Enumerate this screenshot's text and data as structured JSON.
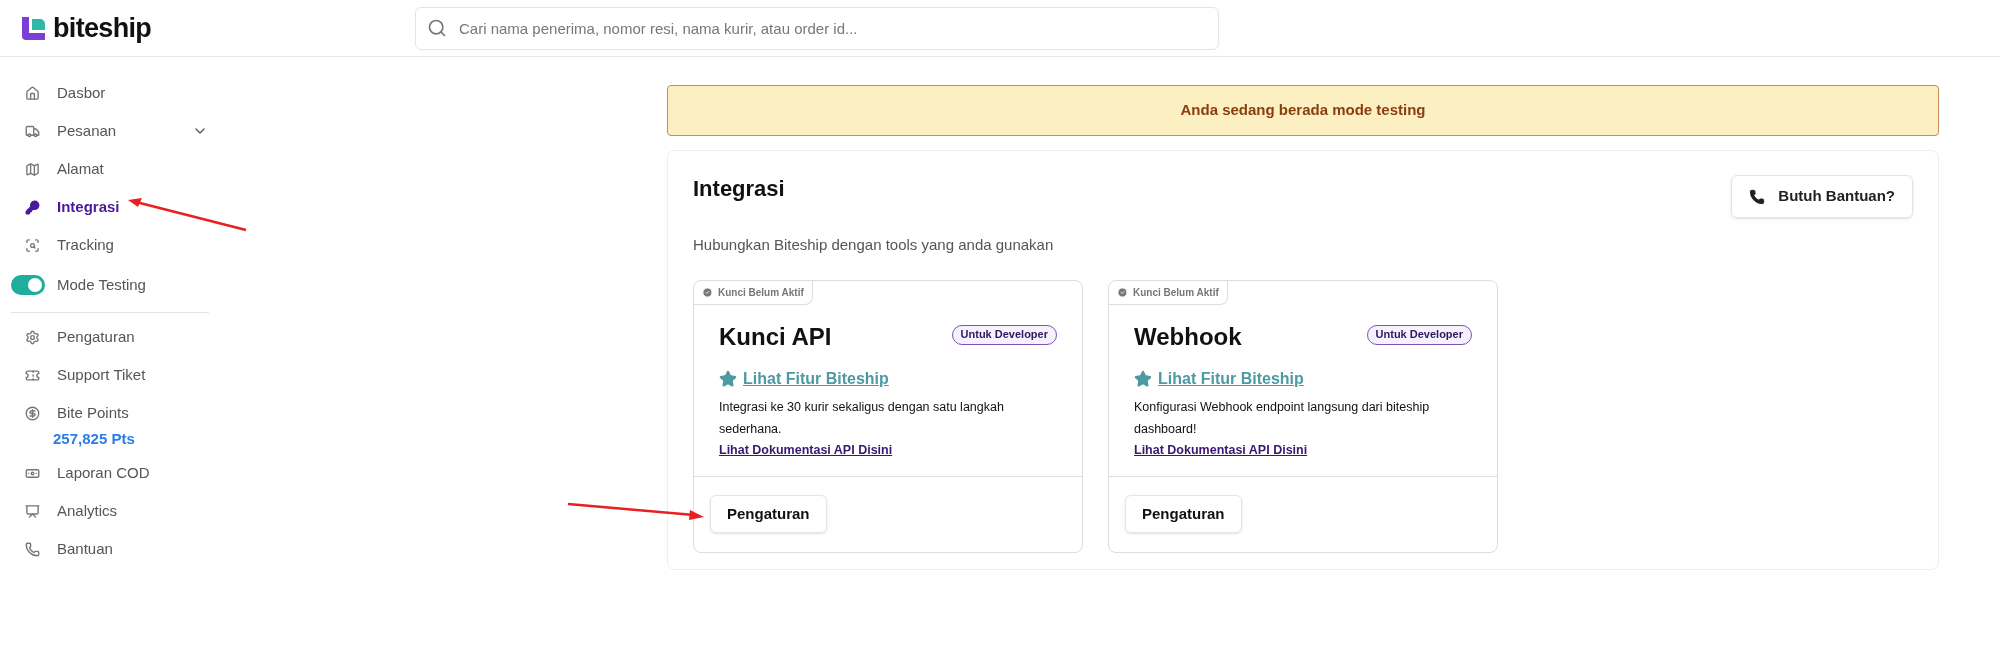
{
  "header": {
    "logo": "biteship",
    "search": {
      "placeholder": "Cari nama penerima, nomor resi, nama kurir, atau order id..."
    }
  },
  "sidebar": {
    "primary": [
      {
        "label": "Dasbor",
        "selected": false
      },
      {
        "label": "Pesanan",
        "selected": false,
        "expanded": false
      },
      {
        "label": "Alamat",
        "selected": false
      },
      {
        "label": "Integrasi",
        "selected": true
      },
      {
        "label": "Tracking",
        "selected": false
      }
    ],
    "mode_toggle": {
      "label": "Mode Testing",
      "on": true
    },
    "secondary": [
      {
        "label": "Pengaturan",
        "selected": false
      },
      {
        "label": "Support Tiket",
        "selected": false
      },
      {
        "label": "Bite Points",
        "selected": false,
        "points": "257,825 Pts"
      },
      {
        "label": "Laporan COD",
        "selected": false
      },
      {
        "label": "Analytics",
        "selected": false
      },
      {
        "label": "Bantuan",
        "selected": false
      }
    ]
  },
  "banner": "Anda sedang berada mode testing",
  "panel": {
    "title": "Integrasi",
    "help_button": "Butuh Bantuan?",
    "subtitle": "Hubungkan Biteship dengan tools yang anda gunakan",
    "cards": [
      {
        "status": "Kunci Belum Aktif",
        "title": "Kunci API",
        "badge": "Untuk Developer",
        "feature_link": "Lihat Fitur Biteship",
        "description": "Integrasi ke 30 kurir sekaligus dengan satu langkah sederhana.",
        "docs_link": "Lihat Dokumentasi API Disini",
        "button": "Pengaturan"
      },
      {
        "status": "Kunci Belum Aktif",
        "title": "Webhook",
        "badge": "Untuk Developer",
        "feature_link": "Lihat Fitur Biteship",
        "description": "Konfigurasi Webhook endpoint langsung dari biteship dashboard!",
        "docs_link": "Lihat Dokumentasi API Disini",
        "button": "Pengaturan"
      }
    ]
  }
}
